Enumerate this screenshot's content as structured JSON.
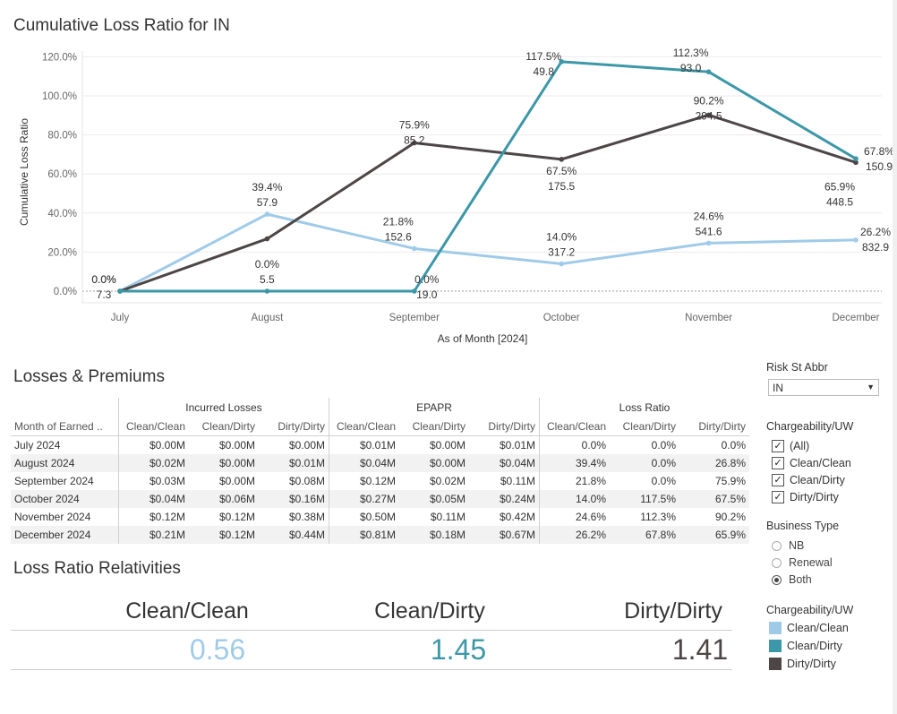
{
  "chart_title": "Cumulative Loss Ratio for IN",
  "chart_data": {
    "type": "line",
    "categories": [
      "July",
      "August",
      "September",
      "October",
      "November",
      "December"
    ],
    "ylabel": "Cumulative Loss Ratio",
    "xlabel": "As of Month [2024]",
    "ylim": [
      0,
      120
    ],
    "yticks": [
      "0.0%",
      "20.0%",
      "40.0%",
      "60.0%",
      "80.0%",
      "100.0%",
      "120.0%"
    ],
    "grid": true,
    "series": [
      {
        "name": "Clean/Clean",
        "color": "#a0cbe8",
        "values": [
          0.0,
          39.4,
          21.8,
          14.0,
          24.6,
          26.2
        ],
        "labels": [
          "0.0%",
          "39.4%",
          "21.8%",
          "14.0%",
          "24.6%",
          "26.2%"
        ],
        "sublabels": [
          "7.3",
          "57.9",
          "152.6",
          "317.2",
          "541.6",
          "832.9"
        ]
      },
      {
        "name": "Clean/Dirty",
        "color": "#3c97a8",
        "values": [
          0.0,
          0.0,
          0.0,
          117.5,
          112.3,
          67.8
        ],
        "labels": [
          "",
          "0.0%",
          "0.0%",
          "117.5%",
          "112.3%",
          "67.8%"
        ],
        "sublabels": [
          "",
          "5.5",
          "19.0",
          "49.8",
          "93.0",
          "150.9"
        ]
      },
      {
        "name": "Dirty/Dirty",
        "color": "#4e4646",
        "values": [
          0.0,
          26.8,
          75.9,
          67.5,
          90.2,
          65.9
        ],
        "labels": [
          "0.0%",
          "",
          "75.9%",
          "67.5%",
          "90.2%",
          "65.9%"
        ],
        "sublabels": [
          "",
          "",
          "85.2",
          "175.5",
          "294.5",
          "448.5"
        ]
      }
    ]
  },
  "table": {
    "title": "Losses & Premiums",
    "groups": [
      "Incurred Losses",
      "EPAPR",
      "Loss Ratio"
    ],
    "row_header": "Month of Earned ..",
    "subheaders": [
      "Clean/Clean",
      "Clean/Dirty",
      "Dirty/Dirty"
    ],
    "rows": [
      {
        "month": "July 2024",
        "vals": [
          "$0.00M",
          "$0.00M",
          "$0.00M",
          "$0.01M",
          "$0.00M",
          "$0.01M",
          "0.0%",
          "0.0%",
          "0.0%"
        ]
      },
      {
        "month": "August 2024",
        "vals": [
          "$0.02M",
          "$0.00M",
          "$0.01M",
          "$0.04M",
          "$0.00M",
          "$0.04M",
          "39.4%",
          "0.0%",
          "26.8%"
        ]
      },
      {
        "month": "September 2024",
        "vals": [
          "$0.03M",
          "$0.00M",
          "$0.08M",
          "$0.12M",
          "$0.02M",
          "$0.11M",
          "21.8%",
          "0.0%",
          "75.9%"
        ]
      },
      {
        "month": "October 2024",
        "vals": [
          "$0.04M",
          "$0.06M",
          "$0.16M",
          "$0.27M",
          "$0.05M",
          "$0.24M",
          "14.0%",
          "117.5%",
          "67.5%"
        ]
      },
      {
        "month": "November 2024",
        "vals": [
          "$0.12M",
          "$0.12M",
          "$0.38M",
          "$0.50M",
          "$0.11M",
          "$0.42M",
          "24.6%",
          "112.3%",
          "90.2%"
        ]
      },
      {
        "month": "December 2024",
        "vals": [
          "$0.21M",
          "$0.12M",
          "$0.44M",
          "$0.81M",
          "$0.18M",
          "$0.67M",
          "26.2%",
          "67.8%",
          "65.9%"
        ]
      }
    ]
  },
  "relativities": {
    "title": "Loss Ratio Relativities",
    "items": [
      {
        "label": "Clean/Clean",
        "value": "0.56",
        "color": "#a0cbe8"
      },
      {
        "label": "Clean/Dirty",
        "value": "1.45",
        "color": "#3c97a8"
      },
      {
        "label": "Dirty/Dirty",
        "value": "1.41",
        "color": "#4e4646"
      }
    ]
  },
  "filters": {
    "risk_state": {
      "label": "Risk St Abbr",
      "value": "IN"
    },
    "chargeability": {
      "label": "Chargeability/UW",
      "options": [
        "(All)",
        "Clean/Clean",
        "Clean/Dirty",
        "Dirty/Dirty"
      ],
      "checked": [
        true,
        true,
        true,
        true
      ]
    },
    "business_type": {
      "label": "Business Type",
      "options": [
        "NB",
        "Renewal",
        "Both"
      ],
      "selected": "Both"
    },
    "legend": {
      "label": "Chargeability/UW",
      "items": [
        {
          "name": "Clean/Clean",
          "color": "#a0cbe8"
        },
        {
          "name": "Clean/Dirty",
          "color": "#3c97a8"
        },
        {
          "name": "Dirty/Dirty",
          "color": "#4e4646"
        }
      ]
    }
  }
}
